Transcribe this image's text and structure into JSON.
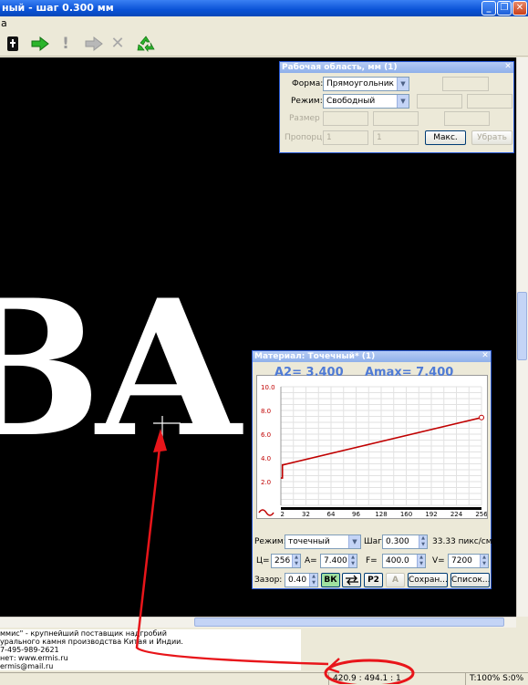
{
  "window": {
    "title": "ный - шаг 0.300 мм",
    "minimize_glyph": "_",
    "restore_glyph": "❐",
    "close_glyph": "✕"
  },
  "menu": {
    "items": [
      "а"
    ]
  },
  "toolbar": {
    "icons": [
      "phone-icon",
      "arrow-right-green-icon",
      "exclamation-icon",
      "arrow-right-gray-icon",
      "close-x-icon",
      "recycle-icon"
    ],
    "exclaim_glyph": "!",
    "x_glyph": "✕"
  },
  "canvas": {
    "text": "BA"
  },
  "work_area_panel": {
    "title": "Рабочая область, мм (1)",
    "close_glyph": "✕",
    "shape_label": "Форма:",
    "shape_value": "Прямоугольник",
    "mode_label": "Режим:",
    "mode_value": "Свободный",
    "size_label": "Размер",
    "proportion_label": "Пропорц",
    "prop_value_1": "1",
    "prop_value_2": "1",
    "max_button": "Макс.",
    "remove_button": "Убрать"
  },
  "material_panel": {
    "title": "Материал: Точечный* (1)",
    "close_glyph": "✕",
    "a2_label": "A2= 3.400",
    "amax_label": "Amax= 7.400",
    "mode_label": "Режим:",
    "mode_value": "точечный",
    "step_label": "Шаг:",
    "step_value": "0.300",
    "pixels_text": "33.33 пикс/см",
    "c_label": "Ц=",
    "c_value": "256",
    "a_label": "A=",
    "a_value": "7.400",
    "f_label": "F=",
    "f_value": "400.0",
    "v_label": "V=",
    "v_value": "7200",
    "gap_label": "Зазор:",
    "gap_value": "0.40",
    "vk_button": "ВК",
    "p2_button": "P2",
    "a_button": "A",
    "save_button": "Сохран...",
    "list_button": "Список..."
  },
  "chart_data": {
    "type": "line",
    "x_ticks": [
      "2",
      "32",
      "64",
      "96",
      "128",
      "160",
      "192",
      "224",
      "256"
    ],
    "y_ticks": [
      "2.0",
      "4.0",
      "6.0",
      "8.0",
      "10.0"
    ],
    "xlim": [
      0,
      256
    ],
    "ylim": [
      0,
      10
    ],
    "grid": true,
    "series": [
      {
        "color": "#c00000",
        "points": [
          [
            0,
            2.3
          ],
          [
            2,
            2.3
          ],
          [
            2,
            3.4
          ],
          [
            256,
            7.4
          ]
        ]
      }
    ]
  },
  "footer": {
    "lines": [
      "ммис\" - крупнейший поставщик надгробий",
      "урального камня производства Китая и Индии.",
      "7-495-989-2621",
      "нет: www.ermis.ru",
      "ermis@mail.ru"
    ]
  },
  "status": {
    "coords": "420.9 : 494.1 : 1",
    "zoom": "T:100% S:0%"
  },
  "colors": {
    "annotation_red": "#e8151a",
    "chart_line": "#c00000",
    "chart_label_blue": "#4f7bd6",
    "panel_border": "#2a5bd7"
  }
}
